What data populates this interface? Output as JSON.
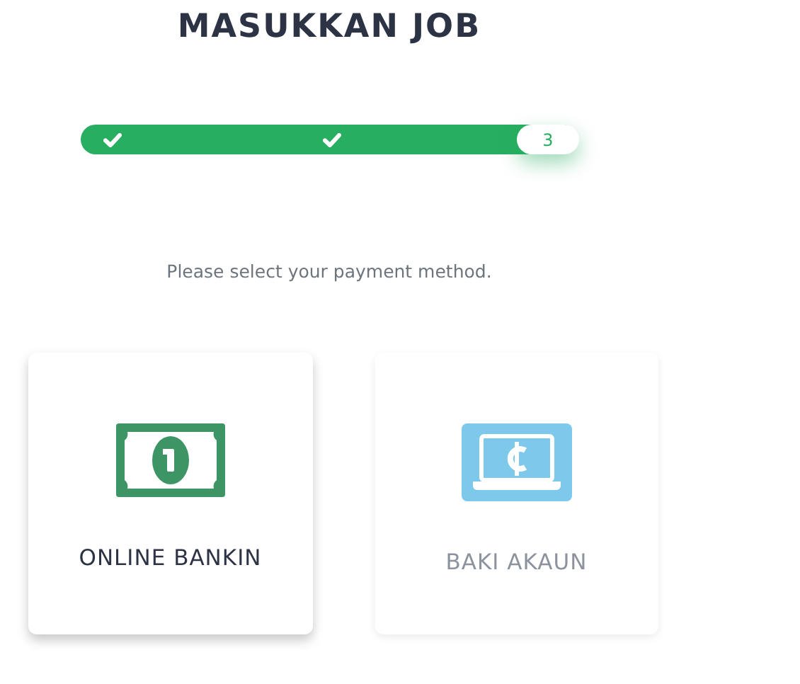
{
  "title": "MASUKKAN JOB",
  "steps": [
    {
      "kind": "done"
    },
    {
      "kind": "done"
    },
    {
      "kind": "current",
      "label": "3"
    }
  ],
  "instruction": "Please select your payment method.",
  "methods": [
    {
      "label": "ONLINE BANKIN",
      "selected": true
    },
    {
      "label": "BAKI AKAUN",
      "selected": false
    }
  ]
}
